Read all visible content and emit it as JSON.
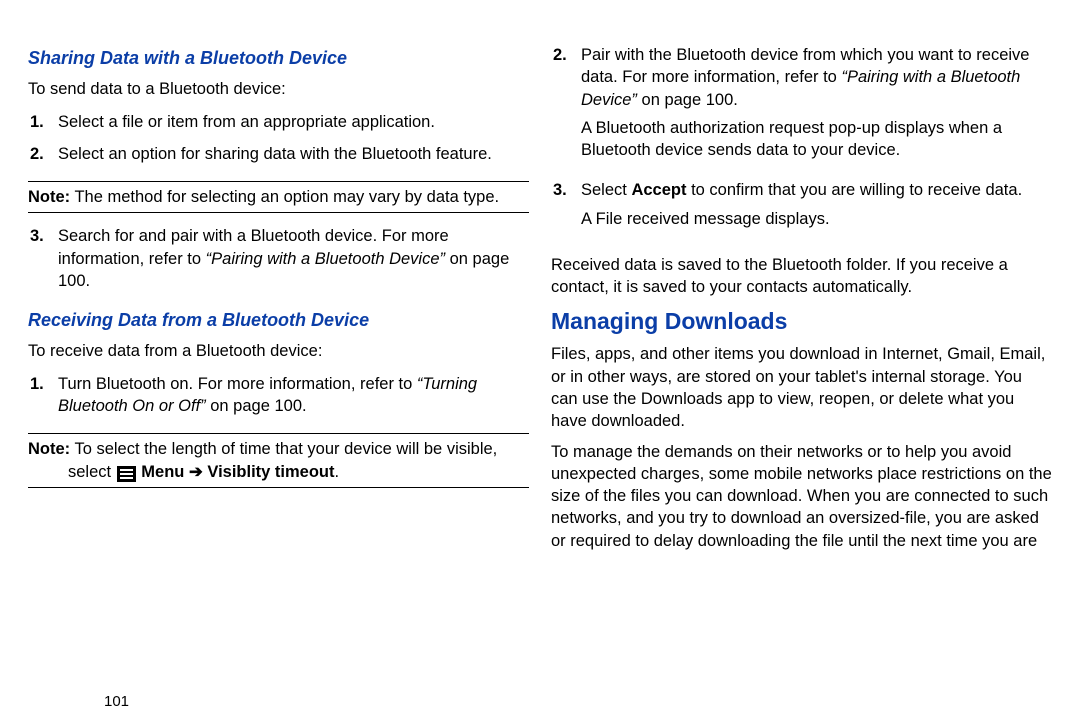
{
  "left": {
    "h_sharing": "Sharing Data with a Bluetooth Device",
    "intro_send": "To send data to a Bluetooth device:",
    "steps_send": {
      "s1": {
        "n": "1.",
        "t": "Select a file or item from an appropriate application."
      },
      "s2": {
        "n": "2.",
        "t": "Select an option for sharing data with the Bluetooth feature."
      }
    },
    "note1_label": "Note:",
    "note1_text": " The method for selecting an option may vary by data type.",
    "steps_send2": {
      "s3_n": "3.",
      "s3_a": "Search for and pair with a Bluetooth device. For more information, refer to ",
      "s3_b": "“Pairing with a Bluetooth Device”",
      "s3_c": " on page 100."
    },
    "h_receiving": "Receiving Data from a Bluetooth Device",
    "intro_recv": "To receive data from a Bluetooth device:",
    "steps_recv": {
      "s1_n": "1.",
      "s1_a": "Turn Bluetooth on. For more information, refer to ",
      "s1_b": "“Turning Bluetooth On or Off”",
      "s1_c": " on page 100."
    },
    "note2_label": "Note:",
    "note2_a": " To select the length of time that your device will be visible, select ",
    "note2_menu": "Menu",
    "note2_arrow": " ➔ ",
    "note2_vis": "Visiblity timeout",
    "note2_end": "."
  },
  "right": {
    "s2": {
      "n": "2.",
      "a": "Pair with the Bluetooth device from which you want to receive data. For more information, refer to ",
      "b": "“Pairing with a Bluetooth Device”",
      "c": " on page 100."
    },
    "s2_para": "A Bluetooth authorization request pop-up displays when a Bluetooth device sends data to your device.",
    "s3": {
      "n": "3.",
      "a": "Select ",
      "b": "Accept",
      "c": " to confirm that you are willing to receive data."
    },
    "s3_para": "A File received message displays.",
    "recv_saved": "Received data is saved to the Bluetooth folder. If you receive a contact, it is saved to your contacts automatically.",
    "h_managing": "Managing Downloads",
    "m_p1": "Files, apps, and other items you download in Internet, Gmail, Email, or in other ways, are stored on your tablet's internal storage. You can use the Downloads app to view, reopen, or delete what you have downloaded.",
    "m_p2": "To manage the demands on their networks or to help you avoid unexpected charges, some mobile networks place restrictions on the size of the files you can download. When you are connected to such networks, and you try to download an oversized-file, you are asked or required to delay downloading the file until the next time you are"
  },
  "page_number": "101"
}
